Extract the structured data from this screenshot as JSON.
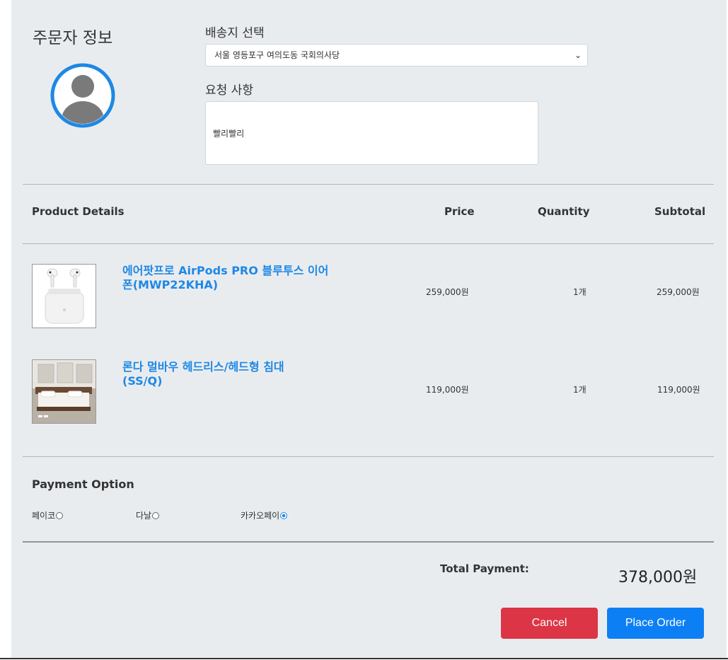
{
  "orderer": {
    "title": "주문자 정보"
  },
  "shipping": {
    "label": "배송지 선택",
    "selected": "서울 영등포구 여의도동 국회의사당"
  },
  "request": {
    "label": "요청 사항",
    "value": "빨리빨리"
  },
  "table": {
    "headers": {
      "product": "Product Details",
      "price": "Price",
      "quantity": "Quantity",
      "subtotal": "Subtotal"
    },
    "rows": [
      {
        "name_line1": "에어팟프로 AirPods PRO 블루투스 이어",
        "name_line2": "폰(MWP22KHA)",
        "price": "259,000원",
        "quantity": "1개",
        "subtotal": "259,000원",
        "image": "airpods-image"
      },
      {
        "name_line1": "론다 멀바우 헤드리스/헤드형 침대",
        "name_line2": "(SS/Q)",
        "price": "119,000원",
        "quantity": "1개",
        "subtotal": "119,000원",
        "image": "bed-image"
      }
    ]
  },
  "payment": {
    "title": "Payment Option",
    "options": [
      {
        "label": "페이코",
        "checked": false
      },
      {
        "label": "다날",
        "checked": false
      },
      {
        "label": "카카오페이",
        "checked": true
      }
    ]
  },
  "total": {
    "label": "Total Payment:",
    "value": "378,000원"
  },
  "buttons": {
    "cancel": "Cancel",
    "order": "Place Order"
  },
  "colors": {
    "accent": "#0d7ff5",
    "danger": "#dc3545",
    "link": "#1e88e5",
    "panel": "#e9ecef"
  }
}
